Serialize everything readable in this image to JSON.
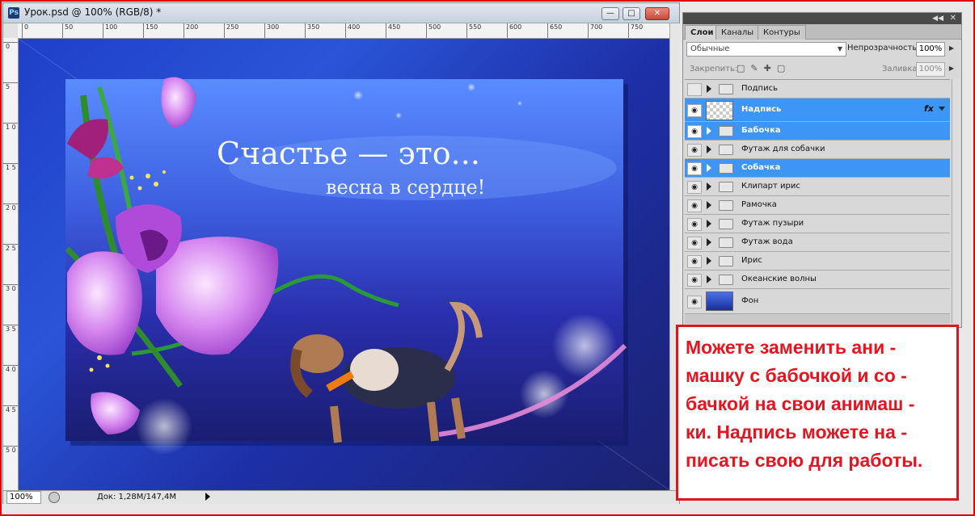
{
  "document": {
    "title": "Урок.psd @ 100% (RGB/8) *",
    "app_icon": "Ps",
    "ruler_h": [
      "0",
      "50",
      "100",
      "150",
      "200",
      "250",
      "300",
      "350",
      "400",
      "450",
      "500",
      "550",
      "600",
      "650",
      "700",
      "750"
    ],
    "ruler_v": [
      "0",
      "5",
      "1 0",
      "1 5",
      "2 0",
      "2 5",
      "3 0",
      "3 5",
      "4 0",
      "4 5",
      "5 0"
    ],
    "canvas": {
      "heading": "Счастье — это...",
      "subheading": "весна в сердце!"
    },
    "status": {
      "zoom": "100%",
      "doc_info": "Док: 1,28M/147,4M"
    }
  },
  "layers_panel": {
    "tabs": [
      "Слои",
      "Каналы",
      "Контуры"
    ],
    "active_tab": "Слои",
    "blend_mode": "Обычные",
    "opacity_label": "Непрозрачность:",
    "opacity_value": "100%",
    "lock_label": "Закрепить:",
    "fill_label": "Заливка:",
    "fill_value": "100%",
    "fx_label": "fx",
    "layers": [
      {
        "name": "Подпись",
        "type": "group",
        "visible": false,
        "selected": false
      },
      {
        "name": "Надпись",
        "type": "text-layer",
        "visible": true,
        "selected": true
      },
      {
        "name": "Бабочка",
        "type": "group",
        "visible": true,
        "selected": true
      },
      {
        "name": "Футаж для собачки",
        "type": "group",
        "visible": true,
        "selected": false
      },
      {
        "name": "Собачка",
        "type": "group",
        "visible": true,
        "selected": true
      },
      {
        "name": "Клипарт ирис",
        "type": "group",
        "visible": true,
        "selected": false
      },
      {
        "name": "Рамочка",
        "type": "group",
        "visible": true,
        "selected": false
      },
      {
        "name": "Футаж пузыри",
        "type": "group",
        "visible": true,
        "selected": false
      },
      {
        "name": "Футаж вода",
        "type": "group",
        "visible": true,
        "selected": false
      },
      {
        "name": "Ирис",
        "type": "group",
        "visible": true,
        "selected": false
      },
      {
        "name": "Океанские волны",
        "type": "group",
        "visible": true,
        "selected": false
      },
      {
        "name": "Фон",
        "type": "background",
        "visible": true,
        "selected": false
      }
    ]
  },
  "note": {
    "lines": [
      "Можете заменить ани -",
      "машку с бабочкой и со -",
      "бачкой на свои анимаш -",
      "ки. Надпись можете на -",
      "писать свою для работы."
    ]
  },
  "colors": {
    "frame_border": "#e00000",
    "note_text": "#e8131e",
    "layer_selected": "#3d95f5"
  }
}
